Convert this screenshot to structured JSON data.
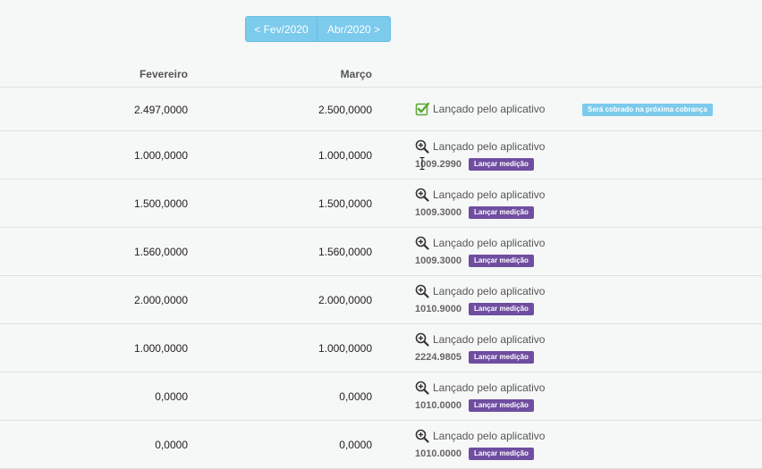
{
  "nav": {
    "prev_label": "< Fev/2020",
    "next_label": "Abr/2020 >"
  },
  "columns": {
    "feb": "Fevereiro",
    "mar": "Março"
  },
  "status_text": "Lançado pelo aplicativo",
  "action_label": "Lançar medição",
  "badge_label": "Será cobrado na próxima cobrança",
  "rows": [
    {
      "feb": "2.497,0000",
      "mar": "2.500,0000",
      "status_icon": "check-icon"
    },
    {
      "feb": "1.000,0000",
      "mar": "1.000,0000",
      "status_icon": "zoom-in-icon",
      "meter": "1009.2990"
    },
    {
      "feb": "1.500,0000",
      "mar": "1.500,0000",
      "status_icon": "zoom-in-icon",
      "meter": "1009.3000"
    },
    {
      "feb": "1.560,0000",
      "mar": "1.560,0000",
      "status_icon": "zoom-in-icon",
      "meter": "1009.3000"
    },
    {
      "feb": "2.000,0000",
      "mar": "2.000,0000",
      "status_icon": "zoom-in-icon",
      "meter": "1010.9000"
    },
    {
      "feb": "1.000,0000",
      "mar": "1.000,0000",
      "status_icon": "zoom-in-icon",
      "meter": "2224.9805"
    },
    {
      "feb": "0,0000",
      "mar": "0,0000",
      "status_icon": "zoom-in-icon",
      "meter": "1010.0000"
    },
    {
      "feb": "0,0000",
      "mar": "0,0000",
      "status_icon": "zoom-in-icon",
      "meter": "1010.0000"
    }
  ],
  "colors": {
    "accent": "#7ccaec",
    "action": "#6f4ea1",
    "check": "#5aa733"
  }
}
